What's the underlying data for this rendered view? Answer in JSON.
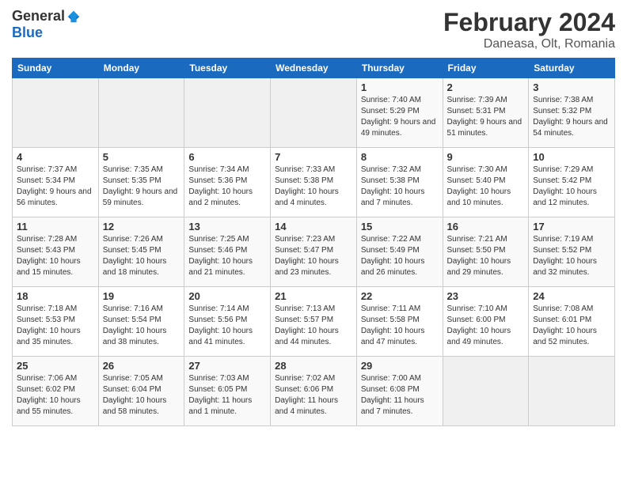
{
  "header": {
    "logo_general": "General",
    "logo_blue": "Blue",
    "title": "February 2024",
    "subtitle": "Daneasa, Olt, Romania"
  },
  "weekdays": [
    "Sunday",
    "Monday",
    "Tuesday",
    "Wednesday",
    "Thursday",
    "Friday",
    "Saturday"
  ],
  "weeks": [
    [
      {
        "day": "",
        "empty": true
      },
      {
        "day": "",
        "empty": true
      },
      {
        "day": "",
        "empty": true
      },
      {
        "day": "",
        "empty": true
      },
      {
        "day": "1",
        "sunrise": "7:40 AM",
        "sunset": "5:29 PM",
        "daylight": "9 hours and 49 minutes."
      },
      {
        "day": "2",
        "sunrise": "7:39 AM",
        "sunset": "5:31 PM",
        "daylight": "9 hours and 51 minutes."
      },
      {
        "day": "3",
        "sunrise": "7:38 AM",
        "sunset": "5:32 PM",
        "daylight": "9 hours and 54 minutes."
      }
    ],
    [
      {
        "day": "4",
        "sunrise": "7:37 AM",
        "sunset": "5:34 PM",
        "daylight": "9 hours and 56 minutes."
      },
      {
        "day": "5",
        "sunrise": "7:35 AM",
        "sunset": "5:35 PM",
        "daylight": "9 hours and 59 minutes."
      },
      {
        "day": "6",
        "sunrise": "7:34 AM",
        "sunset": "5:36 PM",
        "daylight": "10 hours and 2 minutes."
      },
      {
        "day": "7",
        "sunrise": "7:33 AM",
        "sunset": "5:38 PM",
        "daylight": "10 hours and 4 minutes."
      },
      {
        "day": "8",
        "sunrise": "7:32 AM",
        "sunset": "5:38 PM",
        "daylight": "10 hours and 7 minutes."
      },
      {
        "day": "9",
        "sunrise": "7:30 AM",
        "sunset": "5:40 PM",
        "daylight": "10 hours and 10 minutes."
      },
      {
        "day": "10",
        "sunrise": "7:29 AM",
        "sunset": "5:42 PM",
        "daylight": "10 hours and 12 minutes."
      }
    ],
    [
      {
        "day": "11",
        "sunrise": "7:28 AM",
        "sunset": "5:43 PM",
        "daylight": "10 hours and 15 minutes."
      },
      {
        "day": "12",
        "sunrise": "7:26 AM",
        "sunset": "5:45 PM",
        "daylight": "10 hours and 18 minutes."
      },
      {
        "day": "13",
        "sunrise": "7:25 AM",
        "sunset": "5:46 PM",
        "daylight": "10 hours and 21 minutes."
      },
      {
        "day": "14",
        "sunrise": "7:23 AM",
        "sunset": "5:47 PM",
        "daylight": "10 hours and 23 minutes."
      },
      {
        "day": "15",
        "sunrise": "7:22 AM",
        "sunset": "5:49 PM",
        "daylight": "10 hours and 26 minutes."
      },
      {
        "day": "16",
        "sunrise": "7:21 AM",
        "sunset": "5:50 PM",
        "daylight": "10 hours and 29 minutes."
      },
      {
        "day": "17",
        "sunrise": "7:19 AM",
        "sunset": "5:52 PM",
        "daylight": "10 hours and 32 minutes."
      }
    ],
    [
      {
        "day": "18",
        "sunrise": "7:18 AM",
        "sunset": "5:53 PM",
        "daylight": "10 hours and 35 minutes."
      },
      {
        "day": "19",
        "sunrise": "7:16 AM",
        "sunset": "5:54 PM",
        "daylight": "10 hours and 38 minutes."
      },
      {
        "day": "20",
        "sunrise": "7:14 AM",
        "sunset": "5:56 PM",
        "daylight": "10 hours and 41 minutes."
      },
      {
        "day": "21",
        "sunrise": "7:13 AM",
        "sunset": "5:57 PM",
        "daylight": "10 hours and 44 minutes."
      },
      {
        "day": "22",
        "sunrise": "7:11 AM",
        "sunset": "5:58 PM",
        "daylight": "10 hours and 47 minutes."
      },
      {
        "day": "23",
        "sunrise": "7:10 AM",
        "sunset": "6:00 PM",
        "daylight": "10 hours and 49 minutes."
      },
      {
        "day": "24",
        "sunrise": "7:08 AM",
        "sunset": "6:01 PM",
        "daylight": "10 hours and 52 minutes."
      }
    ],
    [
      {
        "day": "25",
        "sunrise": "7:06 AM",
        "sunset": "6:02 PM",
        "daylight": "10 hours and 55 minutes."
      },
      {
        "day": "26",
        "sunrise": "7:05 AM",
        "sunset": "6:04 PM",
        "daylight": "10 hours and 58 minutes."
      },
      {
        "day": "27",
        "sunrise": "7:03 AM",
        "sunset": "6:05 PM",
        "daylight": "11 hours and 1 minute."
      },
      {
        "day": "28",
        "sunrise": "7:02 AM",
        "sunset": "6:06 PM",
        "daylight": "11 hours and 4 minutes."
      },
      {
        "day": "29",
        "sunrise": "7:00 AM",
        "sunset": "6:08 PM",
        "daylight": "11 hours and 7 minutes."
      },
      {
        "day": "",
        "empty": true
      },
      {
        "day": "",
        "empty": true
      }
    ]
  ],
  "labels": {
    "sunrise": "Sunrise:",
    "sunset": "Sunset:",
    "daylight": "Daylight:"
  }
}
